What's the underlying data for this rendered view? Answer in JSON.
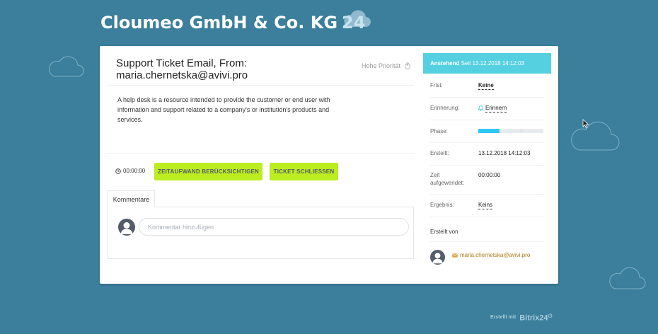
{
  "header": {
    "company": "Cloumeo GmbH & Co. KG",
    "number": "24"
  },
  "ticket": {
    "title": "Support Ticket Email, From: maria.chernetska@avivi.pro",
    "priority": "Hohe Priorität",
    "description": "A help desk is a resource intended to provide the customer or end user with information and support related to a company's or institution's products and services."
  },
  "actions": {
    "timer": "00:00:00",
    "time_button": "ZEITAUFWAND BERÜCKSICHTIGEN",
    "close_button": "TICKET SCHLIESSEN"
  },
  "comments": {
    "tab": "Kommentare",
    "placeholder": "Kommentar hinzufügen"
  },
  "status": {
    "state": "Anstehend",
    "since": "Seit 13.12.2018 14:12:03"
  },
  "details": {
    "deadline_label": "Frist:",
    "deadline_value": "Keine",
    "reminder_label": "Erinnerung:",
    "reminder_value": "Erinnern",
    "phase_label": "Phase:",
    "phase_progress": 0.33,
    "created_label": "Erstellt:",
    "created_value": "13.12.2018 14:12:03",
    "time_spent_label": "Zeit aufgewendet:",
    "time_spent_value": "00:00:00",
    "result_label": "Ergebnis:",
    "result_value": "Keins",
    "created_by_label": "Erstellt von",
    "creator_email": "maria.chernetska@avivi.pro"
  },
  "footer": {
    "made_with": "Erstellt mit",
    "brand": "Bitrix24"
  },
  "colors": {
    "background": "#3b7f9c",
    "status_header": "#55d0e0",
    "action_button": "#bbed21",
    "phase_fill": "#2fc6f6",
    "creator_link": "#b0791a"
  },
  "icons": [
    "cloud-icon",
    "fire-icon",
    "clock-icon",
    "bell-icon",
    "user-icon",
    "mail-icon"
  ]
}
